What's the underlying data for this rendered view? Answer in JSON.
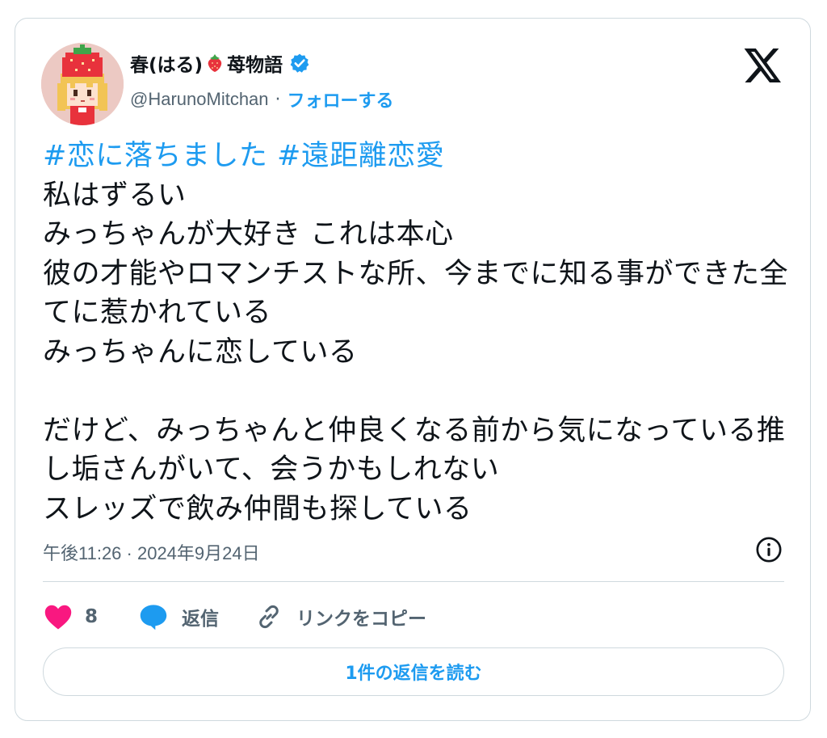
{
  "author": {
    "display_name": "春(はる)",
    "name_suffix": "苺物語",
    "handle": "@HarunoMitchan",
    "separator": "·",
    "follow_label": "フォローする"
  },
  "tweet": {
    "hashtags": [
      "#恋に落ちました",
      "#遠距離恋愛"
    ],
    "body": "私はずるい\nみっちゃんが大好き これは本心\n彼の才能やロマンチストな所、今までに知る事ができた全てに惹かれている\nみっちゃんに恋している\n\nだけど、みっちゃんと仲良くなる前から気になっている推し垢さんがいて、会うかもしれない\nスレッズで飲み仲間も探している",
    "timestamp": "午後11:26 · 2024年9月24日"
  },
  "actions": {
    "like_count": "8",
    "reply_label": "返信",
    "copy_link_label": "リンクをコピー",
    "read_replies_label": "1件の返信を読む"
  },
  "icons": {
    "avatar": "pixel-art-girl-strawberry-hat",
    "name_emoji": "strawberry-icon",
    "verified": "verified-badge-icon",
    "logo": "x-logo-icon",
    "info": "info-icon",
    "like": "heart-icon",
    "reply": "speech-bubble-icon",
    "copy": "link-icon"
  },
  "colors": {
    "accent": "#1d9bf0",
    "like": "#f91880",
    "text": "#0f1419",
    "secondary": "#536471",
    "border": "#cfd9de"
  }
}
